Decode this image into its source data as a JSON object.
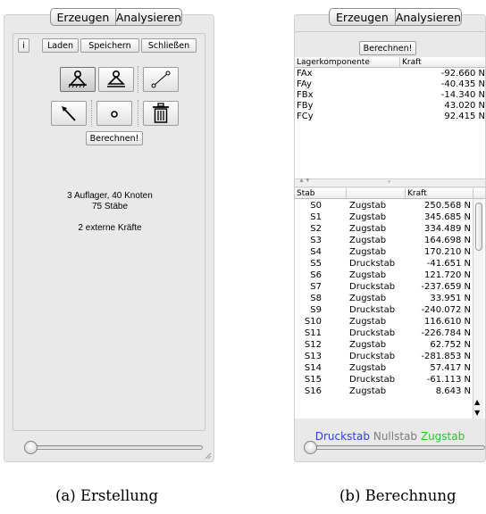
{
  "panel_a": {
    "tabs": [
      "Erzeugen",
      "Analysieren"
    ],
    "toolbar": {
      "info": "i",
      "load": "Laden",
      "save": "Speichern",
      "close": "Schließen"
    },
    "tools": [
      {
        "name": "pinned-support-icon",
        "selected": true
      },
      {
        "name": "roller-support-icon",
        "selected": false
      },
      {
        "name": "bar-icon",
        "selected": false
      },
      {
        "name": "force-arrow-icon",
        "selected": false
      },
      {
        "name": "node-icon",
        "selected": false
      },
      {
        "name": "trash-icon",
        "selected": false
      }
    ],
    "calculate": "Berechnen!",
    "info_line1": "3 Auflager, 40 Knoten",
    "info_line2": "75 Stäbe",
    "info_line3": "2 externe Kräfte",
    "slider_value": 0
  },
  "panel_b": {
    "tabs": [
      "Erzeugen",
      "Analysieren"
    ],
    "calculate": "Berechnen!",
    "support_headers": [
      "Lagerkomponente",
      "Kraft"
    ],
    "supports": [
      {
        "name": "FAx",
        "force": "-92.660 N"
      },
      {
        "name": "FAy",
        "force": "-40.435 N"
      },
      {
        "name": "FBx",
        "force": "-14.340 N"
      },
      {
        "name": "FBy",
        "force": "43.020 N"
      },
      {
        "name": "FCy",
        "force": "92.415 N"
      }
    ],
    "bar_headers": [
      "Stab",
      "",
      "Kraft"
    ],
    "bars": [
      {
        "name": "S0",
        "type": "Zugstab",
        "force": "250.568 N"
      },
      {
        "name": "S1",
        "type": "Zugstab",
        "force": "345.685 N"
      },
      {
        "name": "S2",
        "type": "Zugstab",
        "force": "334.489 N"
      },
      {
        "name": "S3",
        "type": "Zugstab",
        "force": "164.698 N"
      },
      {
        "name": "S4",
        "type": "Zugstab",
        "force": "170.210 N"
      },
      {
        "name": "S5",
        "type": "Druckstab",
        "force": "-41.651 N"
      },
      {
        "name": "S6",
        "type": "Zugstab",
        "force": "121.720 N"
      },
      {
        "name": "S7",
        "type": "Druckstab",
        "force": "-237.659 N"
      },
      {
        "name": "S8",
        "type": "Zugstab",
        "force": "33.951 N"
      },
      {
        "name": "S9",
        "type": "Druckstab",
        "force": "-240.072 N"
      },
      {
        "name": "S10",
        "type": "Zugstab",
        "force": "116.610 N"
      },
      {
        "name": "S11",
        "type": "Druckstab",
        "force": "-226.784 N"
      },
      {
        "name": "S12",
        "type": "Zugstab",
        "force": "62.752 N"
      },
      {
        "name": "S13",
        "type": "Druckstab",
        "force": "-281.853 N"
      },
      {
        "name": "S14",
        "type": "Zugstab",
        "force": "57.417 N"
      },
      {
        "name": "S15",
        "type": "Druckstab",
        "force": "-61.113 N"
      },
      {
        "name": "S16",
        "type": "Zugstab",
        "force": "8.643 N"
      }
    ],
    "legend": {
      "compression": "Druckstab",
      "zero": "Nullstab",
      "tension": "Zugstab"
    },
    "colors": {
      "compression": "#2f3fd6",
      "zero": "#7a7a7a",
      "tension": "#2fc22f"
    },
    "slider_value": 0
  },
  "captions": {
    "a": "(a) Erstellung",
    "b": "(b) Berechnung"
  }
}
